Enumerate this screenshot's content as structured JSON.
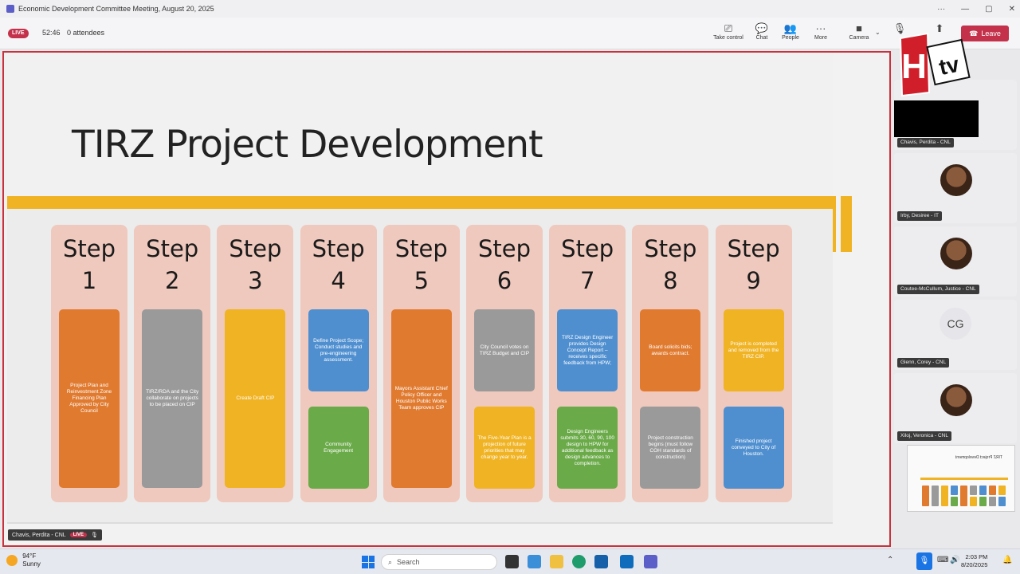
{
  "window": {
    "title": "Economic Development Committee Meeting, August 20, 2025"
  },
  "toolbar": {
    "live_label": "LIVE",
    "timer": "52:46",
    "attendees": "0 attendees",
    "take_control": "Take control",
    "chat": "Chat",
    "people": "People",
    "more": "More",
    "camera": "Camera",
    "leave": "Leave"
  },
  "slide": {
    "title": "TIRZ Project Development",
    "steps": [
      {
        "label": "Step 1",
        "boxes": [
          {
            "color": "orange",
            "text": "Project Plan and Reinvestment Zone Financing Plan Approved by City Council"
          }
        ]
      },
      {
        "label": "Step 2",
        "boxes": [
          {
            "color": "gray",
            "text": "TIRZ/RDA and the City collaborate on projects to be placed on CIP"
          }
        ]
      },
      {
        "label": "Step 3",
        "boxes": [
          {
            "color": "yellow",
            "text": "Create Draft CIP"
          }
        ]
      },
      {
        "label": "Step 4",
        "boxes": [
          {
            "color": "blue",
            "text": "Define Project Scope; Conduct studies and pre-engineering assessment."
          },
          {
            "color": "green",
            "text": "Community Engagement"
          }
        ]
      },
      {
        "label": "Step 5",
        "boxes": [
          {
            "color": "orange",
            "text": "Mayors Assistant Chief Policy Officer and Houston Public Works Team approves CIP"
          }
        ]
      },
      {
        "label": "Step 6",
        "boxes": [
          {
            "color": "gray",
            "text": "City Council votes on TIRZ Budget and CIP"
          },
          {
            "color": "yellow",
            "text": "The Five-Year Plan is a projection of future priorities that may change year to year."
          }
        ]
      },
      {
        "label": "Step 7",
        "boxes": [
          {
            "color": "blue",
            "text": "TIRZ Design Engineer provides Design Concept Report – receives specific feedback from HPW;"
          },
          {
            "color": "green",
            "text": "Design Engineers submits 30, 60, 90, 100 design to HPW for additional feedback as design advances to completion."
          }
        ]
      },
      {
        "label": "Step 8",
        "boxes": [
          {
            "color": "orange",
            "text": "Board solicits bids; awards contract."
          },
          {
            "color": "gray",
            "text": "Project construction begins (must follow COH standards of construction)"
          }
        ]
      },
      {
        "label": "Step 9",
        "boxes": [
          {
            "color": "yellow",
            "text": "Project is completed and removed from the TIRZ CIP."
          },
          {
            "color": "blue",
            "text": "Finished project conveyed to City of Houston."
          }
        ]
      }
    ]
  },
  "presenter": {
    "name": "Chavis, Perdita - CNL",
    "live_label": "LIVE"
  },
  "participants": [
    {
      "name": "Chavis, Perdita - CNL"
    },
    {
      "name": "Irby, Desiree - IT"
    },
    {
      "name": "Coutee-McCullum, Justice - CNL"
    },
    {
      "name": "Glenn, Corey - CNL",
      "initials": "CG"
    },
    {
      "name": "Xiloj, Veronica - CNL"
    }
  ],
  "logo": {
    "letters": "H",
    "suffix": "tv"
  },
  "thumbnail": {
    "title": "TIRZ Project Development"
  },
  "taskbar": {
    "weather_temp": "94°F",
    "weather_desc": "Sunny",
    "search_placeholder": "Search",
    "time": "2:03 PM",
    "date": "8/20/2025"
  }
}
